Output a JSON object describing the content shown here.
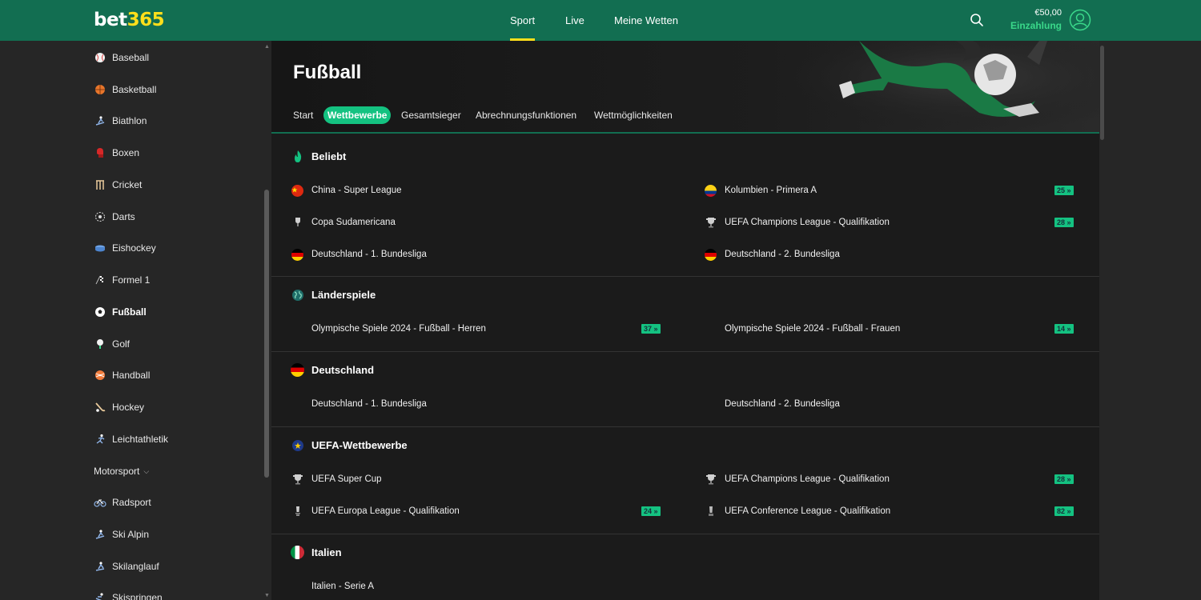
{
  "brand": {
    "part1": "bet",
    "part2": "365"
  },
  "header": {
    "nav": [
      {
        "label": "Sport",
        "active": true
      },
      {
        "label": "Live",
        "active": false
      },
      {
        "label": "Meine Wetten",
        "active": false
      }
    ],
    "balance": "€50,00",
    "deposit_label": "Einzahlung"
  },
  "sidebar": {
    "items": [
      {
        "label": "Baseball",
        "icon": "baseball-icon"
      },
      {
        "label": "Basketball",
        "icon": "basketball-icon"
      },
      {
        "label": "Biathlon",
        "icon": "biathlon-icon"
      },
      {
        "label": "Boxen",
        "icon": "boxing-glove-icon"
      },
      {
        "label": "Cricket",
        "icon": "cricket-icon"
      },
      {
        "label": "Darts",
        "icon": "darts-icon"
      },
      {
        "label": "Eishockey",
        "icon": "ice-hockey-icon"
      },
      {
        "label": "Formel 1",
        "icon": "formula1-icon"
      },
      {
        "label": "Fußball",
        "icon": "football-icon"
      },
      {
        "label": "Golf",
        "icon": "golf-icon"
      },
      {
        "label": "Handball",
        "icon": "handball-icon"
      },
      {
        "label": "Hockey",
        "icon": "hockey-icon"
      },
      {
        "label": "Leichtathletik",
        "icon": "athletics-icon"
      },
      {
        "label": "Motorsport",
        "icon": "chevron-down-icon"
      },
      {
        "label": "Radsport",
        "icon": "cycling-icon"
      },
      {
        "label": "Ski Alpin",
        "icon": "ski-alpine-icon"
      },
      {
        "label": "Skilanglauf",
        "icon": "cross-country-ski-icon"
      },
      {
        "label": "Skispringen",
        "icon": "ski-jumping-icon"
      }
    ]
  },
  "main": {
    "title": "Fußball",
    "tabs": [
      {
        "label": "Start",
        "active": false
      },
      {
        "label": "Wettbewerbe",
        "active": true
      },
      {
        "label": "Gesamtsieger",
        "active": false
      },
      {
        "label": "Abrechnungsfunktionen",
        "active": false
      },
      {
        "label": "Wettmöglichkeiten",
        "active": false
      }
    ],
    "sections": [
      {
        "title": "Beliebt",
        "icon": "flame-icon",
        "entries": [
          {
            "label": "China - Super League",
            "icon": "china-flag-icon",
            "count": ""
          },
          {
            "label": "Kolumbien - Primera A",
            "icon": "colombia-flag-icon",
            "count": "25"
          },
          {
            "label": "Copa Sudamericana",
            "icon": "trophy-icon",
            "count": ""
          },
          {
            "label": "UEFA Champions League - Qualifikation",
            "icon": "trophy-icon",
            "count": "28"
          },
          {
            "label": "Deutschland - 1. Bundesliga",
            "icon": "germany-flag-icon",
            "count": ""
          },
          {
            "label": "Deutschland - 2. Bundesliga",
            "icon": "germany-flag-icon",
            "count": ""
          }
        ]
      },
      {
        "title": "Länderspiele",
        "icon": "globe-icon",
        "entries": [
          {
            "label": "Olympische Spiele 2024 - Fußball - Herren",
            "count": "37"
          },
          {
            "label": "Olympische Spiele 2024 - Fußball - Frauen",
            "count": "14"
          }
        ]
      },
      {
        "title": "Deutschland",
        "icon": "germany-flag-icon",
        "entries": [
          {
            "label": "Deutschland - 1. Bundesliga",
            "count": ""
          },
          {
            "label": "Deutschland - 2. Bundesliga",
            "count": ""
          }
        ]
      },
      {
        "title": "UEFA-Wettbewerbe",
        "icon": "eu-stars-icon",
        "entries": [
          {
            "label": "UEFA Super Cup",
            "icon": "trophy-icon",
            "count": ""
          },
          {
            "label": "UEFA Champions League - Qualifikation",
            "icon": "trophy-icon",
            "count": "28"
          },
          {
            "label": "UEFA Europa League - Qualifikation",
            "icon": "trophy-icon",
            "count": "24"
          },
          {
            "label": "UEFA Conference League - Qualifikation",
            "icon": "trophy-icon",
            "count": "82"
          }
        ]
      },
      {
        "title": "Italien",
        "icon": "italy-flag-icon",
        "entries": [
          {
            "label": "Italien - Serie A",
            "count": ""
          }
        ]
      }
    ]
  },
  "colors": {
    "brand_green": "#126e51",
    "accent": "#14c281",
    "yellow": "#ffdf1b"
  }
}
